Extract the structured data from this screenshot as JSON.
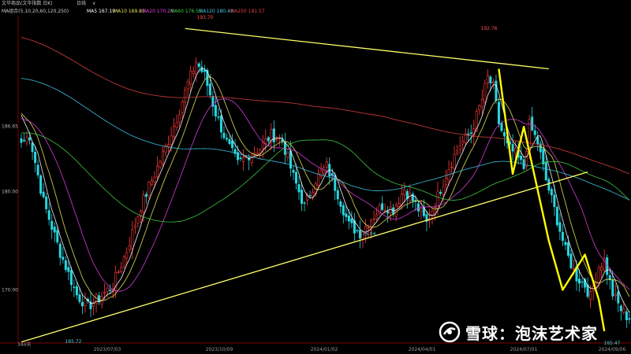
{
  "header": {
    "instrument": "文华商品(文华指数 日K)",
    "period": "日线",
    "menu_arrow": "∨",
    "ma_params": "MA组合(5,10,20,60,120,250)"
  },
  "ma_legend": [
    {
      "label": "MA5",
      "value": "167.19",
      "color": "#ffffff"
    },
    {
      "label": "MA10",
      "value": "169.85",
      "color": "#e8e85a"
    },
    {
      "label": "MA20",
      "value": "170.28",
      "color": "#e040e0"
    },
    {
      "label": "MA60",
      "value": "176.55",
      "color": "#40d040"
    },
    {
      "label": "MA120",
      "value": "180.49",
      "color": "#40c8e8"
    },
    {
      "label": "MA250",
      "value": "181.57",
      "color": "#e04040"
    }
  ],
  "watermark": {
    "text": "雪球：泡沫艺术家"
  },
  "chart_data": {
    "type": "candlestick",
    "ylim": [
      164.6,
      197.9
    ],
    "y_ticks": [
      {
        "value": 180.0,
        "label": "180.00"
      },
      {
        "value": 170.0,
        "label": "170.00"
      }
    ],
    "x_ticks": [
      "2023/07/03",
      "2023/10/09",
      "2024/01/02",
      "2024/04/01",
      "2024/07/01",
      "2024/09/06"
    ],
    "left_labels": [
      {
        "value": 186.65,
        "label": "186.65"
      }
    ],
    "bottom_left_label": "344天",
    "annotations": [
      {
        "label": "193.70",
        "kind": "high"
      },
      {
        "label": "192.76",
        "kind": "high"
      },
      {
        "label": "175.04",
        "kind": "low"
      },
      {
        "label": "165.72",
        "kind": "low"
      },
      {
        "label": "165.47",
        "kind": "low"
      }
    ],
    "colors": {
      "up": "#ff3b3b",
      "down": "#29d6e0",
      "trendline": "#ffff66",
      "wave": "#ffff00"
    },
    "close_anchors": [
      [
        0,
        185.0
      ],
      [
        3,
        185.7
      ],
      [
        8,
        179.0
      ],
      [
        14,
        173.8
      ],
      [
        20,
        169.5
      ],
      [
        24,
        168.3
      ],
      [
        28,
        169.2
      ],
      [
        33,
        170.5
      ],
      [
        38,
        174.0
      ],
      [
        43,
        178.5
      ],
      [
        48,
        181.8
      ],
      [
        52,
        184.5
      ],
      [
        56,
        187.5
      ],
      [
        60,
        191.0
      ],
      [
        63,
        193.2
      ],
      [
        66,
        191.8
      ],
      [
        70,
        188.0
      ],
      [
        74,
        185.0
      ],
      [
        78,
        182.8
      ],
      [
        82,
        183.8
      ],
      [
        86,
        184.4
      ],
      [
        90,
        185.8
      ],
      [
        94,
        185.2
      ],
      [
        98,
        181.5
      ],
      [
        102,
        178.5
      ],
      [
        106,
        181.2
      ],
      [
        110,
        182.6
      ],
      [
        114,
        179.8
      ],
      [
        118,
        176.6
      ],
      [
        122,
        175.8
      ],
      [
        126,
        177.2
      ],
      [
        130,
        178.6
      ],
      [
        134,
        178.2
      ],
      [
        138,
        180.3
      ],
      [
        142,
        178.7
      ],
      [
        146,
        176.8
      ],
      [
        150,
        179.6
      ],
      [
        154,
        182.5
      ],
      [
        158,
        184.8
      ],
      [
        162,
        186.0
      ],
      [
        166,
        189.4
      ],
      [
        168,
        191.6
      ],
      [
        170,
        190.6
      ],
      [
        172,
        187.0
      ],
      [
        175,
        184.6
      ],
      [
        178,
        183.8
      ],
      [
        181,
        182.4
      ],
      [
        183,
        186.8
      ],
      [
        186,
        185.0
      ],
      [
        189,
        181.2
      ],
      [
        192,
        178.2
      ],
      [
        196,
        174.0
      ],
      [
        200,
        171.3
      ],
      [
        203,
        170.5
      ],
      [
        205,
        169.3
      ],
      [
        208,
        172.4
      ],
      [
        210,
        173.0
      ],
      [
        213,
        169.6
      ],
      [
        216,
        168.0
      ],
      [
        219,
        167.0
      ]
    ],
    "wave_points": [
      [
        172,
        192.5
      ],
      [
        177,
        181.8
      ],
      [
        181,
        186.6
      ],
      [
        190,
        175.0
      ],
      [
        195,
        170.0
      ],
      [
        203,
        173.6
      ],
      [
        208,
        169.0
      ],
      [
        210,
        165.8
      ]
    ],
    "trendlines": [
      {
        "from": [
          0,
          164.7
        ],
        "to": [
          204,
          182.0
        ]
      },
      {
        "from": [
          59,
          196.6
        ],
        "to": [
          190,
          192.5
        ]
      }
    ]
  }
}
